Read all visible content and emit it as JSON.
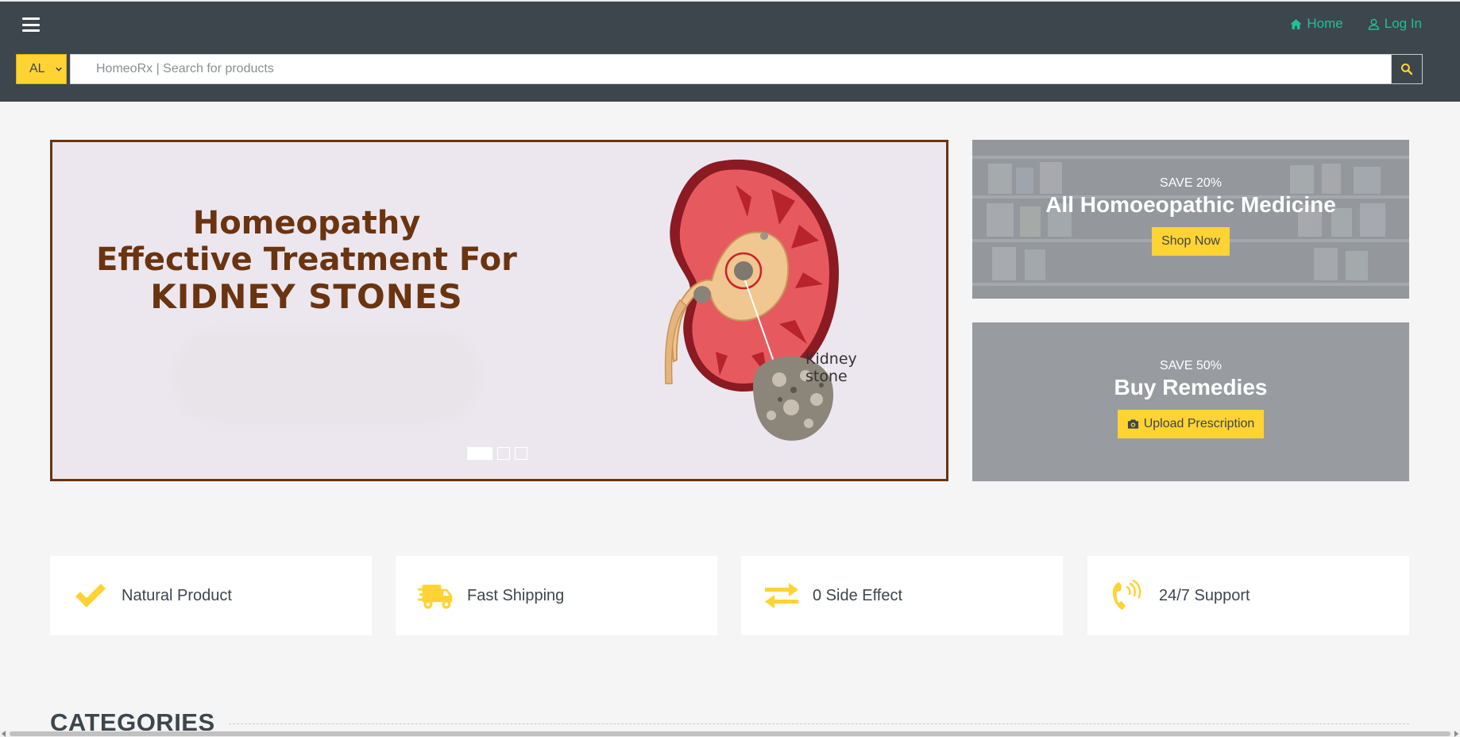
{
  "header": {
    "nav": {
      "home_label": "Home",
      "login_label": "Log In"
    },
    "search": {
      "category_value": "AL",
      "placeholder": "HomeoRx | Search for products"
    }
  },
  "hero": {
    "slide_line1": "Homeopathy",
    "slide_line2": "Effective Treatment For",
    "slide_line3": "KIDNEY STONES",
    "image_label_line1": "Kidney",
    "image_label_line2": "stone",
    "indicators": 3,
    "active_indicator": 1
  },
  "promos": [
    {
      "subtitle": "SAVE 20%",
      "title": "All Homoeopathic Medicine",
      "button": "Shop Now"
    },
    {
      "subtitle": "SAVE 50%",
      "title": "Buy Remedies",
      "button": "Upload Prescription"
    }
  ],
  "features": [
    {
      "label": "Natural Product",
      "icon": "check-icon"
    },
    {
      "label": "Fast Shipping",
      "icon": "shipping-truck-icon"
    },
    {
      "label": "0 Side Effect",
      "icon": "exchange-arrows-icon"
    },
    {
      "label": "24/7 Support",
      "icon": "phone-volume-icon"
    }
  ],
  "categories": {
    "title": "CATEGORIES"
  },
  "colors": {
    "topbar": "#3d464d",
    "accent_yellow": "#ffd333",
    "link_green": "#1cc29a",
    "slide_text_brown": "#6b3410",
    "page_bg": "#f5f5f5"
  }
}
